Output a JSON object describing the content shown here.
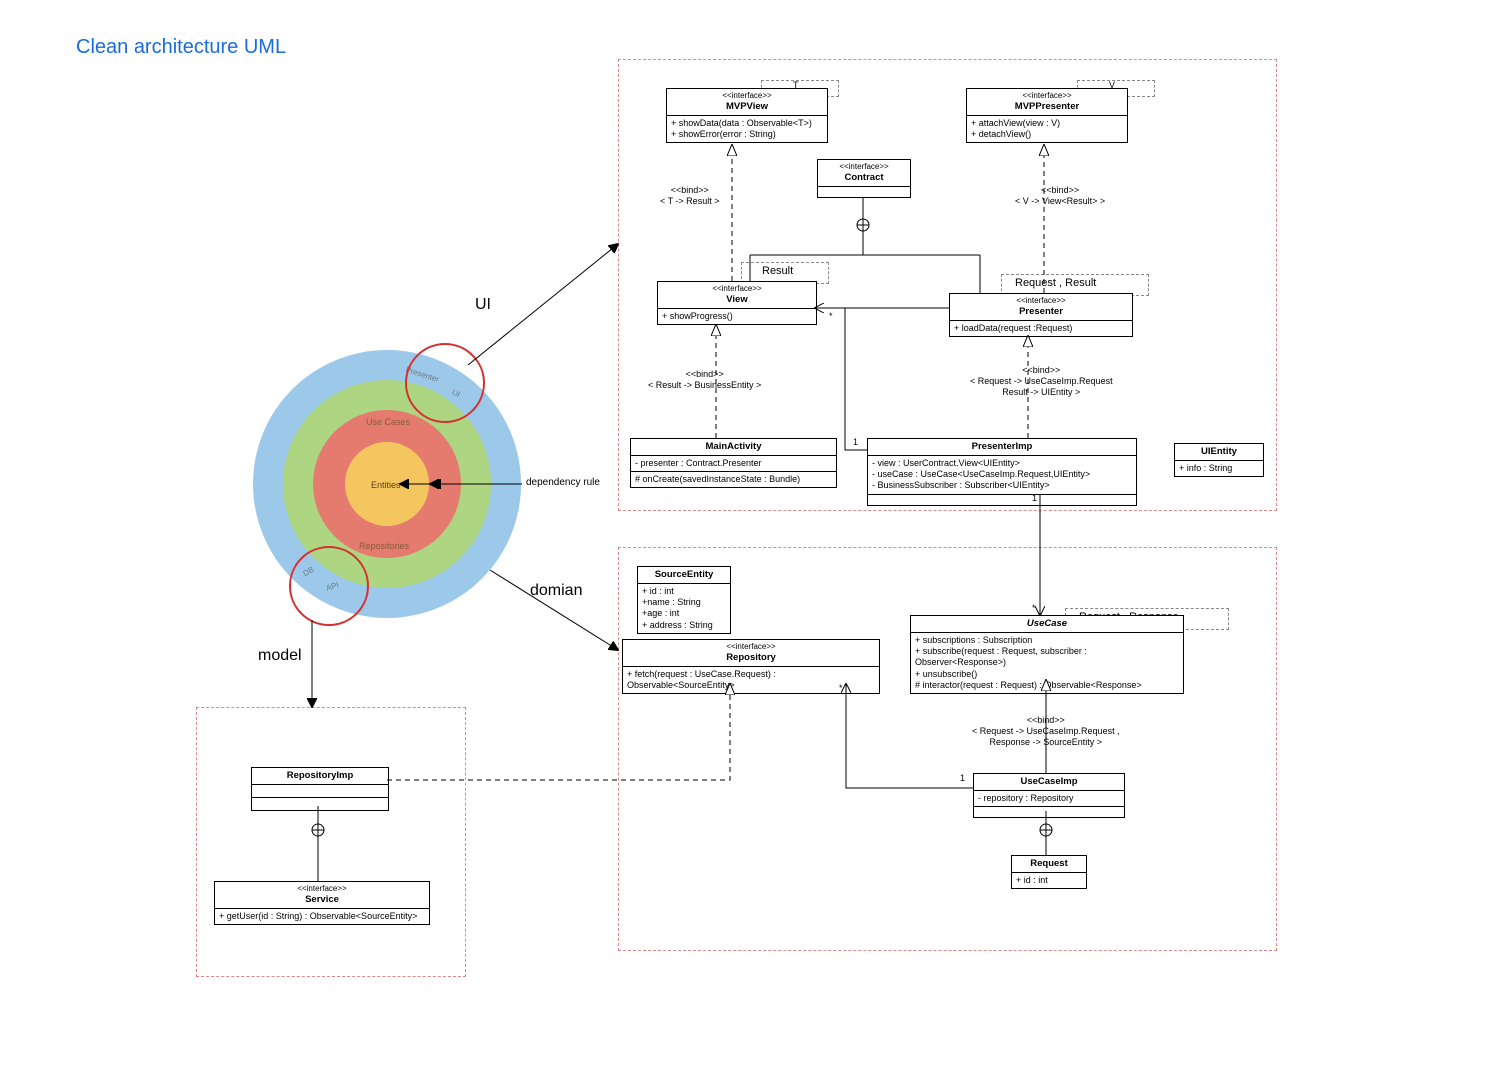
{
  "title": "Clean architecture UML",
  "labels": {
    "ui": "UI",
    "domain": "domian",
    "model": "model",
    "dependency_rule": "dependency rule"
  },
  "rings": {
    "entities": "Entities",
    "usecases": "Use Cases",
    "repositories": "Repositories",
    "presenter": "Presenter",
    "ui": "UI",
    "db": "DB",
    "api": "API"
  },
  "template_params": {
    "t": "T",
    "v": "V",
    "result": "Result",
    "request_result": "Request , Result",
    "request_response": "Request , Response"
  },
  "annotations": {
    "bind_t_result": "<<bind>>\n< T -> Result >",
    "bind_v_view_result": "<<bind>>\n< V -> View<Result> >",
    "bind_result_business": "<<bind>>\n< Result -> BusinessEntity >",
    "bind_req_usecase": "<<bind>>\n< Request -> UseCaseImp.Request\nResult -> UIEntity >",
    "bind_req_resp": "<<bind>>\n< Request -> UseCaseImp.Request ,\nResponse -> SourceEntity >"
  },
  "mult": {
    "one1": "1",
    "one2": "1",
    "one3": "1",
    "star1": "*",
    "star2": "*",
    "star3": "*"
  },
  "classes": {
    "mvpview": {
      "stereo": "<<interface>>",
      "name": "MVPView",
      "ops": [
        "+ showData(data : Observable<T>)",
        "+ showError(error : String)"
      ]
    },
    "mvppresenter": {
      "stereo": "<<interface>>",
      "name": "MVPPresenter",
      "ops": [
        "+ attachView(view : V)",
        "+ detachView()"
      ]
    },
    "contract": {
      "stereo": "<<interface>>",
      "name": "Contract"
    },
    "view": {
      "stereo": "<<interface>>",
      "name": "View",
      "ops": [
        "+ showProgress()"
      ]
    },
    "presenter": {
      "stereo": "<<interface>>",
      "name": "Presenter",
      "ops": [
        "+ loadData(request :Request)"
      ]
    },
    "mainactivity": {
      "name": "MainActivity",
      "attrs": [
        "- presenter : Contract.Presenter"
      ],
      "ops": [
        "# onCreate(savedInstanceState : Bundle)"
      ]
    },
    "presenterimp": {
      "name": "PresenterImp",
      "attrs": [
        "- view : UserContract.View<UIEntity>",
        "- useCase : UseCase<UseCaseImp.Request,UIEntity>",
        "- BusinessSubscriber : Subscriber<UIEntity>"
      ]
    },
    "uientity": {
      "name": "UIEntity",
      "attrs": [
        "+ info : String"
      ]
    },
    "sourceentity": {
      "name": "SourceEntity",
      "attrs": [
        "+ id : int",
        "+name : String",
        "+age : int",
        "+ address : String"
      ]
    },
    "repository": {
      "stereo": "<<interface>>",
      "name": "Repository",
      "ops": [
        "+ fetch(request : UseCase.Request) : Observable<SourceEntity>"
      ]
    },
    "usecase": {
      "name": "UseCase",
      "ops": [
        "+ subscriptions : Subscription",
        "+ subscribe(request : Request, subscriber : Observer<Response>)",
        "+ unsubscribe()",
        "# interactor(request : Request) : Observable<Response>"
      ]
    },
    "usecaseimp": {
      "name": "UseCaseImp",
      "attrs": [
        "- repository : Repository"
      ]
    },
    "request": {
      "name": "Request",
      "attrs": [
        "+ id : int"
      ]
    },
    "repositoryimp": {
      "name": "RepositoryImp"
    },
    "service": {
      "stereo": "<<interface>>",
      "name": "Service",
      "ops": [
        "+ getUser(id : String) : Observable<SourceEntity>"
      ]
    }
  }
}
